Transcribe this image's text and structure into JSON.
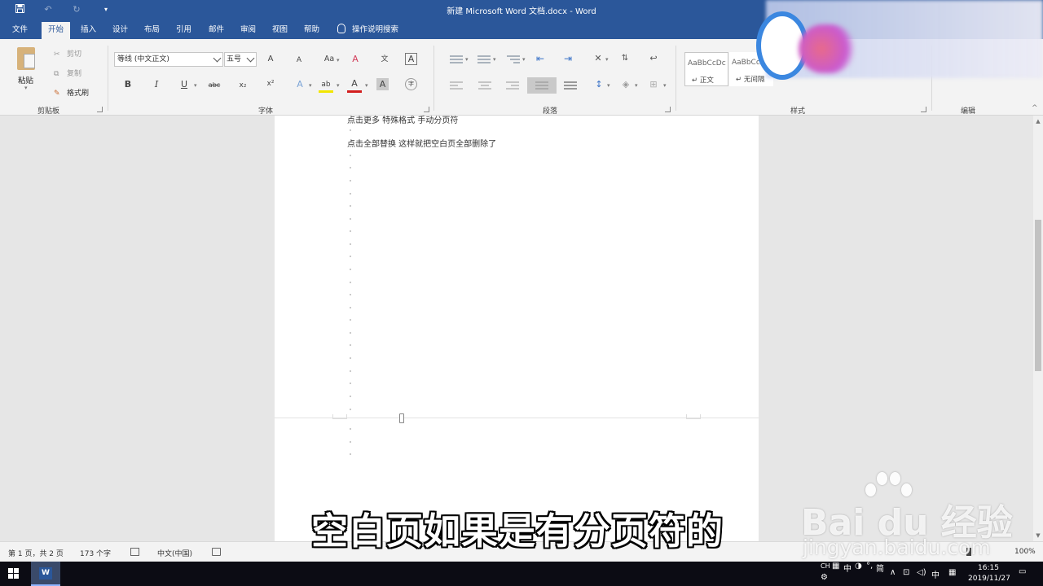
{
  "window": {
    "title": "新建 Microsoft Word 文档.docx  -  Word"
  },
  "quick_access": {
    "icons": [
      "save-icon",
      "undo-icon",
      "redo-icon",
      "customize-icon"
    ]
  },
  "tabs": [
    {
      "label": "文件"
    },
    {
      "label": "开始",
      "active": true
    },
    {
      "label": "插入"
    },
    {
      "label": "设计"
    },
    {
      "label": "布局"
    },
    {
      "label": "引用"
    },
    {
      "label": "邮件"
    },
    {
      "label": "审阅"
    },
    {
      "label": "视图"
    },
    {
      "label": "帮助"
    }
  ],
  "tell_me": "操作说明搜索",
  "clipboard": {
    "paste": "粘贴",
    "cut": "剪切",
    "copy": "复制",
    "format_painter": "格式刷",
    "group": "剪贴板"
  },
  "font": {
    "name": "等线 (中文正文)",
    "size": "五号",
    "grow": "A",
    "shrink": "A",
    "change_case": "Aa",
    "clear": "A",
    "phonetic": "文",
    "border": "A",
    "bold": "B",
    "italic": "I",
    "underline": "U",
    "strike": "abc",
    "subscript": "x₂",
    "superscript": "x²",
    "effects": "A",
    "highlight": "ab",
    "color": "A",
    "shading": "A",
    "enclose": "字",
    "group": "字体",
    "font_color_hex": "#d21e1e",
    "highlight_hex": "#f2e600"
  },
  "paragraph": {
    "group": "段落"
  },
  "styles": {
    "cards": [
      {
        "preview": "AaBbCcDc",
        "name": "↵ 正文"
      },
      {
        "preview": "AaBbCcDc",
        "name": "↵ 无间隔"
      }
    ],
    "group": "样式"
  },
  "editing": {
    "group": "编辑"
  },
  "document": {
    "lines": [
      "点击更多 特殊格式 手动分页符",
      "点击全部替换 这样就把空白页全部删除了"
    ]
  },
  "status": {
    "page": "第 1 页，共 2 页",
    "words": "173 个字",
    "language": "中文(中国)",
    "zoom": "100%"
  },
  "taskbar": {
    "ime_top": "CH",
    "ime_mode": "中",
    "ime_simplified": "简",
    "ime_lang": "中",
    "time": "16:15",
    "date": "2019/11/27"
  },
  "overlay": {
    "subtitle": "空白页如果是有分页符的",
    "watermark_main": "Bai  du 经验",
    "watermark_sub": "jingyan.baidu.com"
  },
  "colors": {
    "word_blue": "#2b579a",
    "ribbon_bg": "#f3f3f3",
    "workspace_bg": "#e6e6e6"
  }
}
